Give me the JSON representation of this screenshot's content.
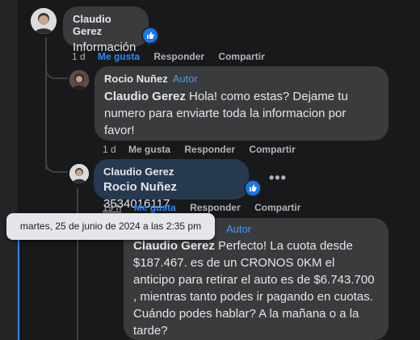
{
  "comments": [
    {
      "author": "Claudio Gerez",
      "text": "Información",
      "time": "1 d",
      "actions": {
        "like": "Me gusta",
        "reply": "Responder",
        "share": "Compartir"
      },
      "liked": true
    },
    {
      "author": "Rocio Nuñez",
      "badge": "Autor",
      "mention": "Claudio Gerez",
      "text": " Hola! como estas? Dejame tu numero para enviarte toda la informacion por favor!",
      "time": "1 d",
      "actions": {
        "like": "Me gusta",
        "reply": "Responder",
        "share": "Compartir"
      }
    },
    {
      "author": "Claudio Gerez",
      "mention": "Rocio Nuñez",
      "text": " 3534016117",
      "time": "19 h",
      "actions": {
        "like": "Me gusta",
        "reply": "Responder",
        "share": "Compartir"
      },
      "liked": true
    },
    {
      "badge": "Autor",
      "mention": "Claudio Gerez",
      "text": " Perfecto! La cuota desde $187.467. es de un CRONOS 0KM el anticipo para retirar el auto es de $6.743.700 , mientras tanto podes ir pagando en cuotas. Cuándo podes hablar? A la mañana o a la tarde?"
    }
  ],
  "tooltip": "martes, 25 de junio de 2024 a las 2:35 pm",
  "more_label": "•••",
  "colors": {
    "accent": "#2d88ff",
    "author_badge": "#4599ff",
    "bubble": "#3a3b3c",
    "highlight_bubble": "#263951"
  }
}
